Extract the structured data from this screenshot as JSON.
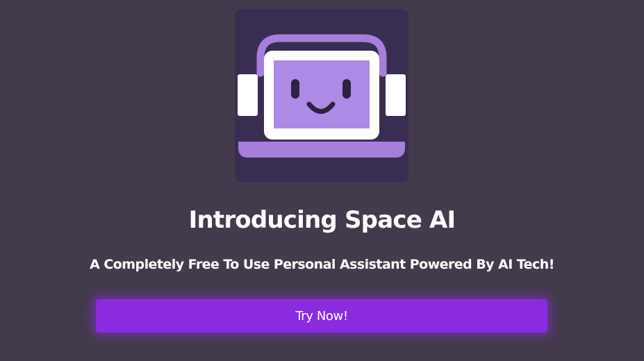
{
  "hero": {
    "logo": {
      "icon": "robot-headphones-icon",
      "colors": {
        "tile": "#3a2d52",
        "accent": "#a67fdd",
        "screen": "#ad8ae5",
        "frame": "#ffffff",
        "face": "#2e2141"
      }
    },
    "title": "Introducing Space AI",
    "subtitle": "A Completely Free To Use Personal Assistant Powered By AI Tech!",
    "cta_label": "Try Now!"
  },
  "colors": {
    "background": "#433b4b",
    "button": "#8a2be2",
    "text": "#ffffff"
  }
}
